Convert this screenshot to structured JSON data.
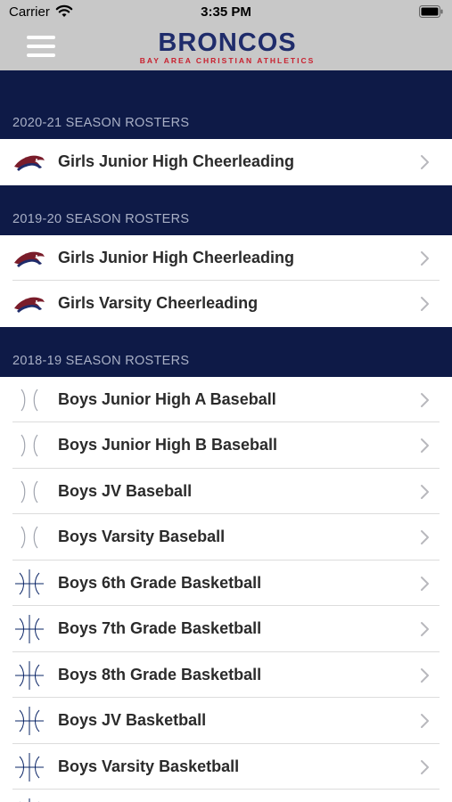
{
  "status_bar": {
    "carrier": "Carrier",
    "time": "3:35 PM"
  },
  "header": {
    "logo_title": "BRONCOS",
    "logo_subtitle": "BAY AREA CHRISTIAN ATHLETICS",
    "colors": {
      "bar": "#c8c8c8",
      "brand_blue": "#1f2c6b",
      "brand_red": "#c8202e"
    }
  },
  "colors": {
    "section_bg": "#0e1a47",
    "section_text": "#a9b0c6"
  },
  "sections": [
    {
      "title": "2020-21 SEASON ROSTERS",
      "items": [
        {
          "label": "Girls Junior High Cheerleading",
          "icon": "bronco-horse-icon"
        }
      ]
    },
    {
      "title": "2019-20 SEASON ROSTERS",
      "items": [
        {
          "label": "Girls Junior High Cheerleading",
          "icon": "bronco-horse-icon"
        },
        {
          "label": "Girls Varsity Cheerleading",
          "icon": "bronco-horse-icon"
        }
      ]
    },
    {
      "title": "2018-19 SEASON ROSTERS",
      "items": [
        {
          "label": "Boys Junior High A Baseball",
          "icon": "baseball-icon"
        },
        {
          "label": "Boys Junior High B Baseball",
          "icon": "baseball-icon"
        },
        {
          "label": "Boys JV Baseball",
          "icon": "baseball-icon"
        },
        {
          "label": "Boys Varsity Baseball",
          "icon": "baseball-icon"
        },
        {
          "label": "Boys 6th Grade Basketball",
          "icon": "basketball-icon"
        },
        {
          "label": "Boys 7th Grade Basketball",
          "icon": "basketball-icon"
        },
        {
          "label": "Boys 8th Grade Basketball",
          "icon": "basketball-icon"
        },
        {
          "label": "Boys JV Basketball",
          "icon": "basketball-icon"
        },
        {
          "label": "Boys Varsity Basketball",
          "icon": "basketball-icon"
        },
        {
          "label": "",
          "icon": "basketball-icon"
        }
      ]
    }
  ]
}
